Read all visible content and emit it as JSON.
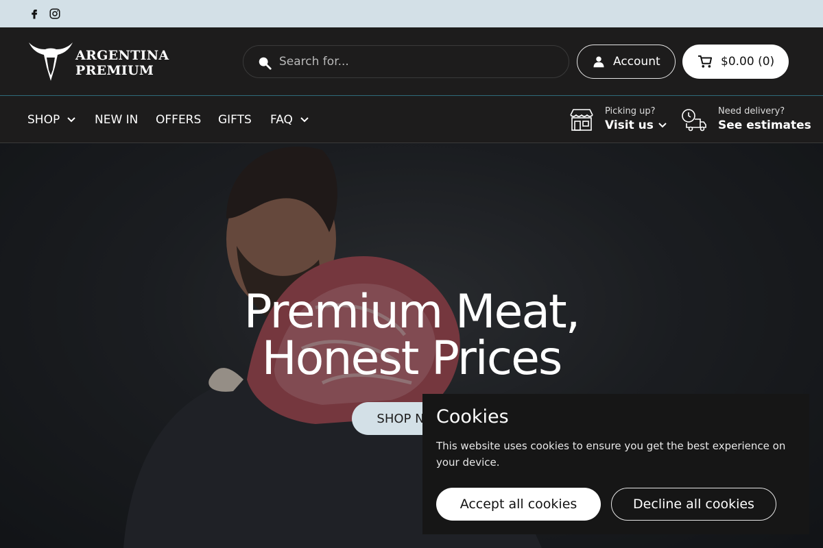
{
  "topbar": {
    "social": [
      {
        "icon": "facebook-icon"
      },
      {
        "icon": "instagram-icon"
      }
    ]
  },
  "header": {
    "logo_line1": "ARGENTINA",
    "logo_line2": "PREMIUM",
    "search_placeholder": "Search for...",
    "account_label": "Account",
    "cart_label": "$0.00 (0)"
  },
  "nav": {
    "items": [
      {
        "label": "SHOP",
        "has_dropdown": true
      },
      {
        "label": "NEW IN",
        "has_dropdown": false
      },
      {
        "label": "OFFERS",
        "has_dropdown": false
      },
      {
        "label": "GIFTS",
        "has_dropdown": false
      },
      {
        "label": "FAQ",
        "has_dropdown": true
      }
    ],
    "pickup": {
      "small": "Picking up?",
      "big": "Visit us"
    },
    "delivery": {
      "small": "Need delivery?",
      "big": "See estimates"
    }
  },
  "hero": {
    "title_line1": "Premium Meat,",
    "title_line2": "Honest Prices",
    "cta_label": "SHOP NOW"
  },
  "cookie": {
    "title": "Cookies",
    "text": "This website uses cookies to ensure you get the best experience on your device.",
    "accept_label": "Accept all cookies",
    "decline_label": "Decline all cookies"
  },
  "colors": {
    "topbar_bg": "#d3e0e7",
    "header_bg": "#1d1c1c",
    "accent": "#d3e0e7"
  }
}
